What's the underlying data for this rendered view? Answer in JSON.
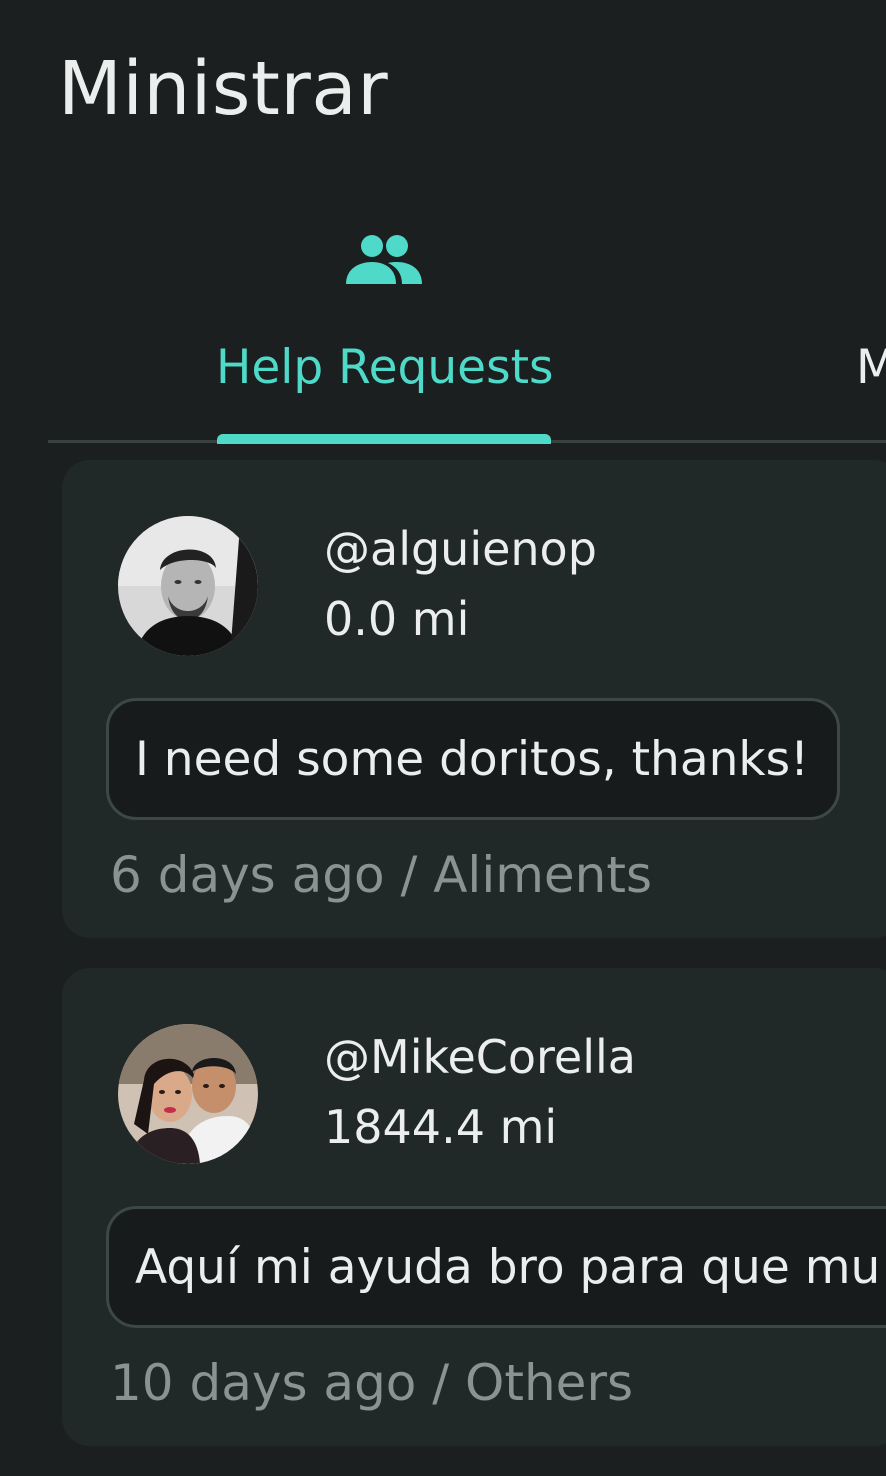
{
  "app": {
    "title": "Ministrar"
  },
  "tabs": [
    {
      "label": "Help Requests",
      "icon": "people-icon",
      "active": true
    },
    {
      "label": "M",
      "active": false
    }
  ],
  "colors": {
    "accent": "#4ed9c9",
    "background": "#1c1f1f",
    "card": "#202828"
  },
  "requests": [
    {
      "username": "@alguienop",
      "distance": "0.0 mi",
      "message": "I need some doritos, thanks!",
      "time_ago": "6 days ago",
      "category": "Aliments",
      "meta": "6 days ago / Aliments"
    },
    {
      "username": "@MikeCorella",
      "distance": "1844.4 mi",
      "message": "Aquí mi ayuda bro para que mu",
      "time_ago": "10 days ago",
      "category": "Others",
      "meta": "10 days ago / Others"
    }
  ]
}
